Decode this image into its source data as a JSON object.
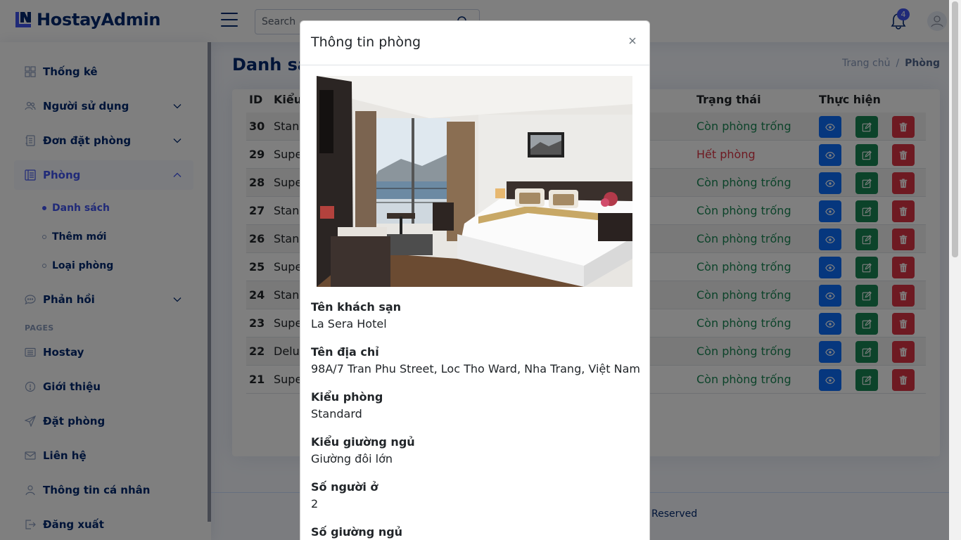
{
  "header": {
    "logo_text": "HostayAdmin",
    "search_placeholder": "Search",
    "notification_count": "4"
  },
  "sidebar": {
    "items": [
      {
        "label": "Thống kê",
        "icon": "grid-icon"
      },
      {
        "label": "Người sử dụng",
        "icon": "people-icon"
      },
      {
        "label": "Đơn đặt phòng",
        "icon": "journal-icon"
      },
      {
        "label": "Phòng",
        "icon": "layout-text-icon"
      },
      {
        "label": "Phản hồi",
        "icon": "chat-icon"
      }
    ],
    "sub_items": [
      {
        "label": "Danh sách"
      },
      {
        "label": "Thêm mới"
      },
      {
        "label": "Loại phòng"
      }
    ],
    "heading": "PAGES",
    "pages": [
      {
        "label": "Hostay",
        "icon": "card-list-icon"
      },
      {
        "label": "Giới thiệu",
        "icon": "info-icon"
      },
      {
        "label": "Đặt phòng",
        "icon": "send-icon"
      },
      {
        "label": "Liên hệ",
        "icon": "envelope-icon"
      },
      {
        "label": "Thông tin cá nhân",
        "icon": "person-icon"
      },
      {
        "label": "Đăng xuất",
        "icon": "logout-icon"
      }
    ]
  },
  "main": {
    "title": "Danh sác",
    "breadcrumb": {
      "home": "Trang chủ",
      "separator": "/",
      "current": "Phòng"
    },
    "table": {
      "headers": {
        "id": "ID",
        "type": "Kiểu",
        "status": "Trạng thái",
        "actions": "Thực hiện"
      },
      "rows": [
        {
          "id": "30",
          "type": "Stand",
          "status": "Còn phòng trống",
          "state": "ok"
        },
        {
          "id": "29",
          "type": "Supe",
          "status": "Hết phòng",
          "state": "full"
        },
        {
          "id": "28",
          "type": "Supe",
          "status": "Còn phòng trống",
          "state": "ok"
        },
        {
          "id": "27",
          "type": "Stand",
          "status": "Còn phòng trống",
          "state": "ok"
        },
        {
          "id": "26",
          "type": "Stand",
          "status": "Còn phòng trống",
          "state": "ok"
        },
        {
          "id": "25",
          "type": "Supe",
          "status": "Còn phòng trống",
          "state": "ok"
        },
        {
          "id": "24",
          "type": "Stand",
          "status": "Còn phòng trống",
          "state": "ok"
        },
        {
          "id": "23",
          "type": "Supe",
          "status": "Còn phòng trống",
          "state": "ok"
        },
        {
          "id": "22",
          "type": "Delux",
          "status": "Còn phòng trống",
          "state": "ok"
        },
        {
          "id": "21",
          "type": "Supe",
          "status": "Còn phòng trống",
          "state": "ok"
        }
      ]
    },
    "footer_text": "Reserved"
  },
  "modal": {
    "title": "Thông tin phòng",
    "fields": [
      {
        "label": "Tên khách sạn",
        "value": "La Sera Hotel"
      },
      {
        "label": "Tên địa chỉ",
        "value": "98A/7 Tran Phu Street, Loc Tho Ward, Nha Trang, Việt Nam"
      },
      {
        "label": "Kiểu phòng",
        "value": "Standard"
      },
      {
        "label": "Kiểu giường ngủ",
        "value": "Giường đôi lớn"
      },
      {
        "label": "Số người ở",
        "value": "2"
      },
      {
        "label": "Số giường ngủ",
        "value": ""
      }
    ]
  },
  "colors": {
    "brand": "#012970",
    "accent": "#4154f1",
    "available": "#198754",
    "full": "#dc3545",
    "view_button": "#0d6efd",
    "edit_button": "#198754",
    "delete_button": "#dc3545"
  }
}
